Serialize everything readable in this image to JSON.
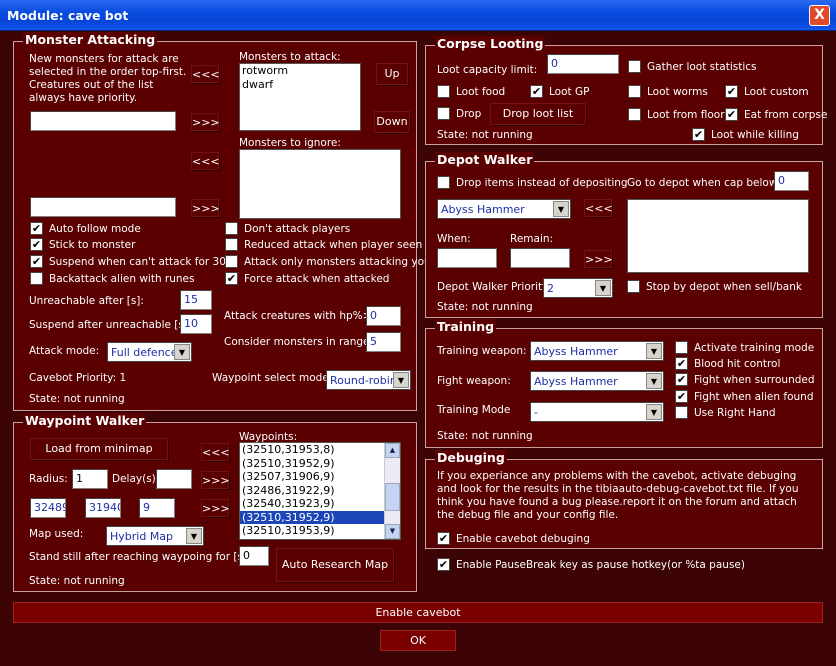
{
  "window": {
    "title": "Module: cave bot",
    "close_label": "X"
  },
  "monster_attacking": {
    "title": "Monster Attacking",
    "info_text": "New monsters for attack are selected in the order top-first. Creatures out of the list always have priority.",
    "new_attack_value": "",
    "new_ignore_value": "",
    "add_attack_label": "<<<",
    "remove_attack_label": ">>>",
    "add_ignore_label": "<<<",
    "remove_ignore_label": ">>>",
    "attack_list_label": "Monsters to attack:",
    "attack_list": [
      "rotworm",
      "dwarf"
    ],
    "ignore_list_label": "Monsters to ignore:",
    "ignore_list": [],
    "up_label": "Up",
    "down_label": "Down",
    "checks": {
      "auto_follow": {
        "label": "Auto follow mode",
        "checked": true
      },
      "stick": {
        "label": "Stick to monster",
        "checked": true
      },
      "suspend": {
        "label": "Suspend when can't attack for 30s",
        "checked": true
      },
      "backattack": {
        "label": "Backattack alien with runes",
        "checked": false
      },
      "dont_attack_players": {
        "label": "Don't attack players",
        "checked": false
      },
      "reduced_attack": {
        "label": "Reduced attack when player seen",
        "checked": false
      },
      "attack_only_attacking": {
        "label": "Attack only monsters attacking you",
        "checked": false
      },
      "force_attack": {
        "label": "Force attack when attacked",
        "checked": true
      }
    },
    "unreachable_label": "Unreachable after [s]:",
    "unreachable_value": "15",
    "suspend_label": "Suspend after unreachable [s]:",
    "suspend_value": "10",
    "attack_hp_label": "Attack creatures with hp%>:",
    "attack_hp_value": "0",
    "consider_range_label": "Consider monsters in range:",
    "consider_range_value": "5",
    "attack_mode_label": "Attack mode:",
    "attack_mode_value": "Full defence",
    "cavebot_priority": "Cavebot Priority: 1",
    "waypoint_mode_label": "Waypoint select mode:",
    "waypoint_mode_value": "Round-robin",
    "state": "State: not running"
  },
  "waypoint_walker": {
    "title": "Waypoint Walker",
    "load_minimap_label": "Load from minimap",
    "radius_label": "Radius:",
    "radius_value": "1",
    "delay_label": "Delay(s)",
    "delay_value": "",
    "x_value": "32489",
    "y_value": "31940",
    "z_value": "9",
    "map_used_label": "Map used:",
    "map_used_value": "Hybrid Map",
    "stand_still_label": "Stand still after reaching waypoing for [s]",
    "stand_still_value": "0",
    "auto_research_label": "Auto Research Map",
    "state": "State: not running",
    "waypoints_label": "Waypoints:",
    "waypoints": [
      "(32510,31953,8)",
      "(32510,31952,9)",
      "(32507,31906,9)",
      "(32486,31922,9)",
      "(32540,31923,9)",
      "(32510,31952,9)",
      "(32510,31953,9)"
    ],
    "selected_index": 5,
    "arrow_1": "<<<",
    "arrow_2": ">>>",
    "arrow_3": ">>>"
  },
  "corpse_looting": {
    "title": "Corpse Looting",
    "capacity_label": "Loot capacity limit:",
    "capacity_value": "0",
    "gather_label": "Gather loot statistics",
    "gather_checked": false,
    "loot_food": {
      "label": "Loot food",
      "checked": false
    },
    "loot_gp": {
      "label": "Loot GP",
      "checked": true
    },
    "loot_worms": {
      "label": "Loot worms",
      "checked": false
    },
    "loot_custom": {
      "label": "Loot custom",
      "checked": true
    },
    "drop": {
      "label": "Drop",
      "checked": false
    },
    "drop_list_label": "Drop loot list",
    "loot_floor": {
      "label": "Loot from floor",
      "checked": false
    },
    "eat_corpse": {
      "label": "Eat from corpse",
      "checked": true
    },
    "loot_killing": {
      "label": "Loot while killing",
      "checked": true
    },
    "state": "State: not running"
  },
  "depot_walker": {
    "title": "Depot Walker",
    "drop_items": {
      "label": "Drop items instead of depositing",
      "checked": false
    },
    "goto_label": "Go to depot when cap below:",
    "goto_value": "0",
    "item_value": "Abyss Hammer",
    "arrow_left": "<<<",
    "arrow_right": ">>>",
    "when_label": "When:",
    "when_value": "",
    "remain_label": "Remain:",
    "remain_value": "",
    "priority_label": "Depot Walker Priority:",
    "priority_value": "2",
    "stop_by_depot": {
      "label": "Stop by depot when sell/bank",
      "checked": false
    },
    "state": "State: not running"
  },
  "training": {
    "title": "Training",
    "training_weapon_label": "Training weapon:",
    "training_weapon_value": "Abyss Hammer",
    "fight_weapon_label": "Fight weapon:",
    "fight_weapon_value": "Abyss Hammer",
    "mode_label": "Training Mode",
    "mode_value": "-",
    "activate": {
      "label": "Activate training mode",
      "checked": false
    },
    "blood_hit": {
      "label": "Blood hit control",
      "checked": true
    },
    "surrounded": {
      "label": "Fight when surrounded",
      "checked": true
    },
    "alien": {
      "label": "Fight when alien found",
      "checked": true
    },
    "right_hand": {
      "label": "Use Right Hand",
      "checked": false
    },
    "state": "State: not running"
  },
  "debugging": {
    "title": "Debuging",
    "text": "If you experiance any problems with the cavebot, activate debuging and look for the results in the tibiaauto-debug-cavebot.txt file. If you think you have found a bug please.report it on the forum and attach the debug file and your config file.",
    "enable": {
      "label": "Enable cavebot debuging",
      "checked": true
    }
  },
  "pausebreak": {
    "label": "Enable PauseBreak key as pause hotkey(or %ta pause)",
    "checked": true
  },
  "enable_cavebot_label": "Enable cavebot",
  "ok_label": "OK"
}
